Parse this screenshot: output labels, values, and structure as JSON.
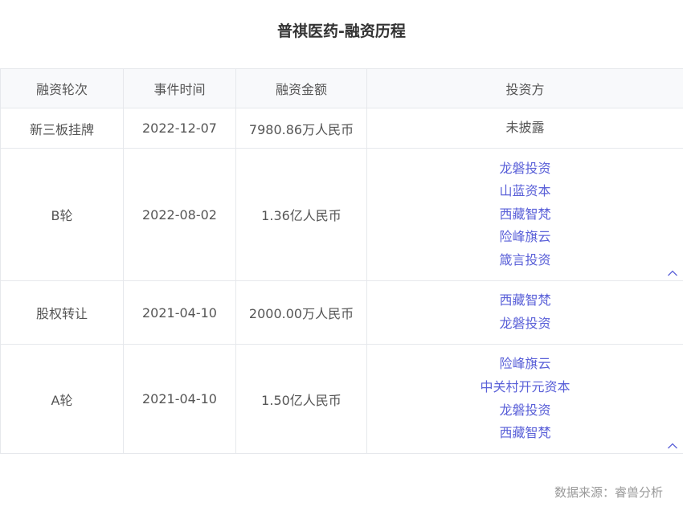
{
  "title": "普祺医药-融资历程",
  "table": {
    "headers": [
      "融资轮次",
      "事件时间",
      "融资金额",
      "投资方"
    ],
    "rows": [
      {
        "round": "新三板挂牌",
        "date": "2022-12-07",
        "amount": "7980.86万人民币",
        "investors": [
          "未披露"
        ],
        "linked": false,
        "collapsible": false
      },
      {
        "round": "B轮",
        "date": "2022-08-02",
        "amount": "1.36亿人民币",
        "investors": [
          "龙磐投资",
          "山蓝资本",
          "西藏智梵",
          "险峰旗云",
          "箴言投资"
        ],
        "linked": true,
        "collapsible": true
      },
      {
        "round": "股权转让",
        "date": "2021-04-10",
        "amount": "2000.00万人民币",
        "investors": [
          "西藏智梵",
          "龙磐投资"
        ],
        "linked": true,
        "collapsible": false
      },
      {
        "round": "A轮",
        "date": "2021-04-10",
        "amount": "1.50亿人民币",
        "investors": [
          "险峰旗云",
          "中关村开元资本",
          "龙磐投资",
          "西藏智梵"
        ],
        "linked": true,
        "collapsible": true
      }
    ]
  },
  "source": "数据来源：睿兽分析",
  "colors": {
    "link": "#5a60d8",
    "text": "#555555",
    "title": "#333333",
    "header_bg": "#f8f9fb",
    "border": "#e6e8ec",
    "source": "#999999"
  }
}
